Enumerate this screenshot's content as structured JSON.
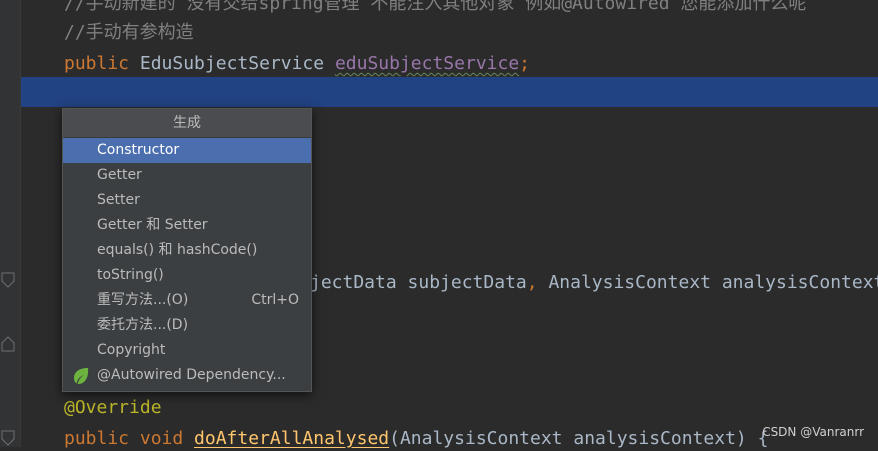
{
  "editor": {
    "line_comment_1": "//手动新建的 没有交给spring管理 不能注入其他对象 例如@Autowired 您能添加什么呢",
    "line_comment_2": "//手动有参构造",
    "line_field_kw": "public",
    "line_field_type": " EduSubjectService ",
    "line_field_name": "eduSubjectService",
    "line_field_semicolon": ";",
    "line_method_tail_1": "jectData subjectData",
    "line_method_comma_1": ", ",
    "line_method_tail_2": "AnalysisContext analysisContext",
    "line_override": "@Override",
    "line_last_kw": "public void ",
    "line_last_method": "doAfterAllAnalysed",
    "line_last_params": "(AnalysisContext analysisContext) {"
  },
  "popup": {
    "title": "生成",
    "items": [
      {
        "label": "Constructor",
        "selected": true
      },
      {
        "label": "Getter"
      },
      {
        "label": "Setter"
      },
      {
        "label": "Getter 和 Setter"
      },
      {
        "label": "equals() 和 hashCode()"
      },
      {
        "label": "toString()"
      },
      {
        "label": "重写方法...(O)",
        "shortcut": "Ctrl+O"
      },
      {
        "label": "委托方法...(D)"
      },
      {
        "label": "Copyright"
      },
      {
        "label": "@Autowired Dependency...",
        "icon": "spring-leaf-icon"
      }
    ]
  },
  "watermark": "CSDN @Vanranrr",
  "colors": {
    "background": "#2b2b2b",
    "selection": "#214283",
    "popup_selected": "#4b6eaf",
    "spring_green": "#6db33f"
  }
}
